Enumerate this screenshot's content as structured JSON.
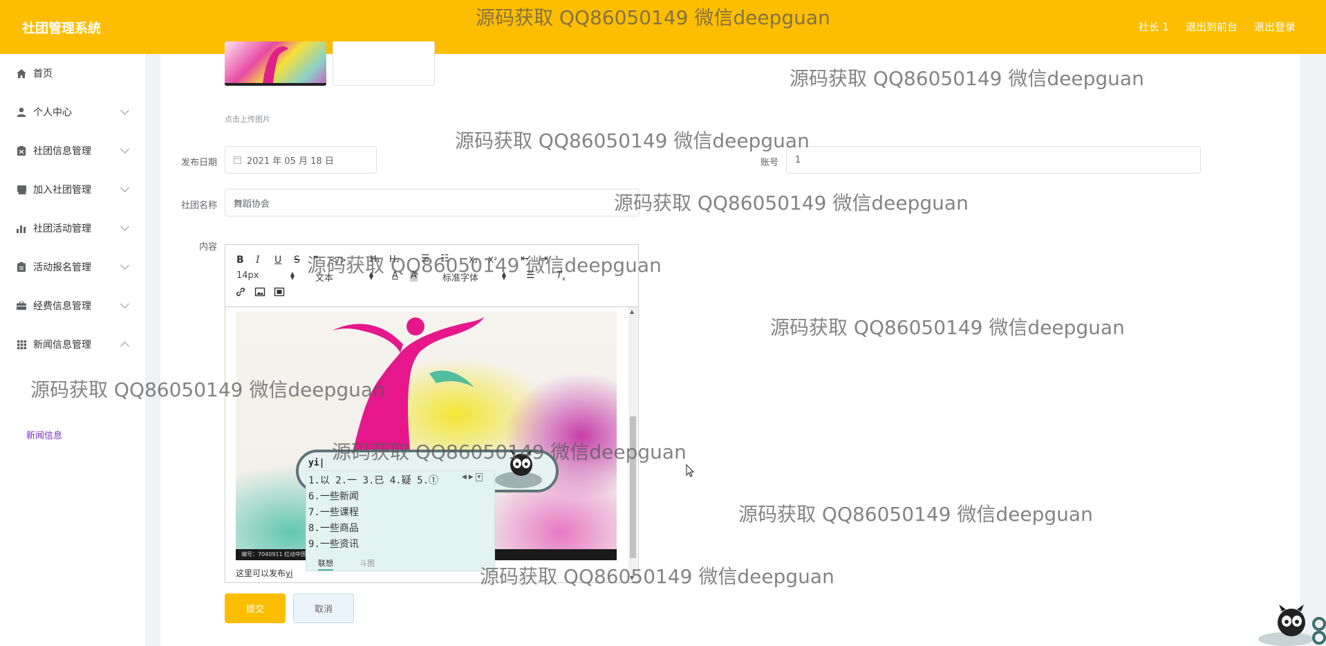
{
  "header": {
    "title": "社团管理系统",
    "links": [
      "社长 1",
      "退出到前台",
      "退出登录"
    ]
  },
  "sidebar": {
    "items": [
      {
        "label": "首页",
        "icon": "home-icon"
      },
      {
        "label": "个人中心",
        "icon": "user-icon"
      },
      {
        "label": "社团信息管理",
        "icon": "clipboard-icon"
      },
      {
        "label": "加入社团管理",
        "icon": "book-icon"
      },
      {
        "label": "社团活动管理",
        "icon": "bar-chart-icon"
      },
      {
        "label": "活动报名管理",
        "icon": "clipboard-list-icon"
      },
      {
        "label": "经费信息管理",
        "icon": "briefcase-icon"
      },
      {
        "label": "新闻信息管理",
        "icon": "grid-icon"
      }
    ],
    "submenu": {
      "label": "新闻信息"
    }
  },
  "form": {
    "upload_tip": "点击上传图片",
    "publish_date": {
      "label": "发布日期",
      "value": "2021 年 05 月 18 日"
    },
    "account": {
      "label": "账号",
      "value": "1"
    },
    "club_name": {
      "label": "社团名称",
      "value": "舞蹈协会"
    },
    "content": {
      "label": "内容"
    }
  },
  "editor": {
    "toolbar": {
      "bold": "B",
      "italic": "I",
      "underline": "U",
      "strike": "S",
      "h1": "H₁",
      "h2": "H₂",
      "sub": "X₂",
      "sup": "X²",
      "font_size": "14px",
      "block_type": "文本",
      "font_family": "标准字体"
    },
    "image_caption": "编号：7040911  红动中国",
    "text_before": "这里可以发布",
    "text_typing": "yi"
  },
  "ime": {
    "input": "yi|",
    "candidates": [
      "1.以 2.一 3.已 4.疑 5.①"
    ],
    "phrases": [
      "6.一些新闻",
      "7.一些课程",
      "8.一些商品",
      "9.一些资讯"
    ],
    "tabs": [
      "联想",
      "斗图"
    ]
  },
  "buttons": {
    "submit": "提交",
    "cancel": "取消"
  },
  "watermark": {
    "text": "源码获取 QQ86050149 微信deepguan"
  },
  "colors": {
    "accent": "#fdbd00",
    "submenu_active": "#7b2cbf"
  }
}
